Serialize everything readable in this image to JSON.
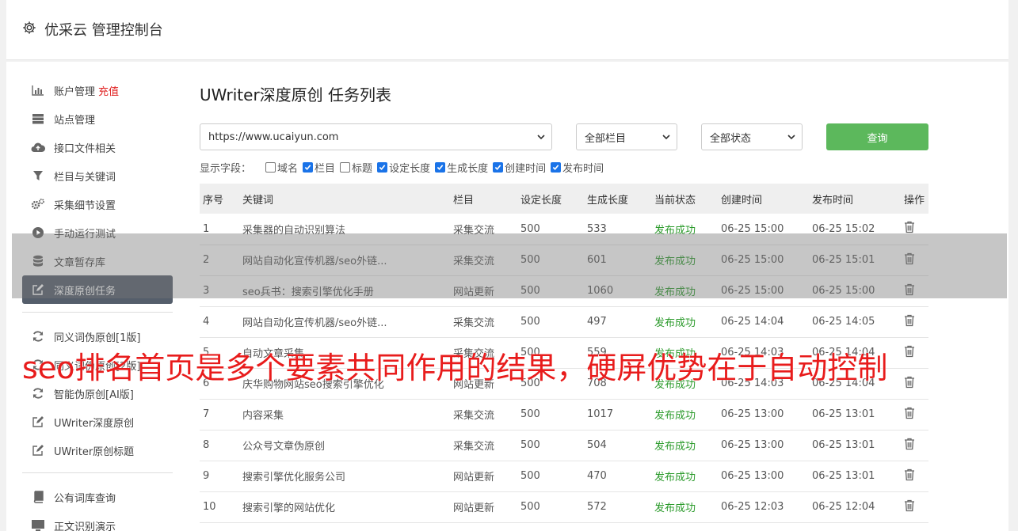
{
  "header": {
    "title": "优采云 管理控制台",
    "icon": "gear-icon"
  },
  "sidebar": {
    "groups": [
      [
        {
          "label": "账户管理",
          "badge": "充值",
          "icon": "bar-chart-icon"
        },
        {
          "label": "站点管理",
          "icon": "server-icon"
        },
        {
          "label": "接口文件相关",
          "icon": "cloud-upload-icon"
        },
        {
          "label": "栏目与关键词",
          "icon": "filter-icon"
        },
        {
          "label": "采集细节设置",
          "icon": "gears-icon"
        },
        {
          "label": "手动运行测试",
          "icon": "play-circle-icon"
        },
        {
          "label": "文章暂存库",
          "icon": "database-icon"
        },
        {
          "label": "深度原创任务",
          "icon": "edit-icon",
          "active": true
        }
      ],
      [
        {
          "label": "同义词伪原创[1版]",
          "icon": "refresh-icon"
        },
        {
          "label": "同义词伪原创[2版]",
          "icon": "refresh-icon"
        },
        {
          "label": "智能伪原创[AI版]",
          "icon": "refresh-icon"
        },
        {
          "label": "UWriter深度原创",
          "icon": "edit-icon"
        },
        {
          "label": "UWriter原创标题",
          "icon": "edit-icon"
        }
      ],
      [
        {
          "label": "公有词库查询",
          "icon": "book-icon"
        },
        {
          "label": "正文识别演示",
          "icon": "monitor-icon"
        }
      ]
    ]
  },
  "main": {
    "title": "UWriter深度原创 任务列表",
    "site_select": "https://www.ucaiyun.com",
    "column_select": "全部栏目",
    "status_select": "全部状态",
    "query_button": "查询",
    "fields_label": "显示字段：",
    "fields": [
      {
        "label": "域名",
        "checked": false
      },
      {
        "label": "栏目",
        "checked": true
      },
      {
        "label": "标题",
        "checked": false
      },
      {
        "label": "设定长度",
        "checked": true
      },
      {
        "label": "生成长度",
        "checked": true
      },
      {
        "label": "创建时间",
        "checked": true
      },
      {
        "label": "发布时间",
        "checked": true
      }
    ],
    "table": {
      "headers": [
        "序号",
        "关键词",
        "栏目",
        "设定长度",
        "生成长度",
        "当前状态",
        "创建时间",
        "发布时间",
        "操作"
      ],
      "rows": [
        [
          "1",
          "采集器的自动识别算法",
          "采集交流",
          "500",
          "533",
          "发布成功",
          "06-25 15:00",
          "06-25 15:02"
        ],
        [
          "2",
          "网站自动化宣传机器/seo外链...",
          "采集交流",
          "500",
          "601",
          "发布成功",
          "06-25 15:00",
          "06-25 15:01"
        ],
        [
          "3",
          "seo兵书：搜索引擎优化手册",
          "网站更新",
          "500",
          "1060",
          "发布成功",
          "06-25 15:00",
          "06-25 15:00"
        ],
        [
          "4",
          "网站自动化宣传机器/seo外链...",
          "采集交流",
          "500",
          "497",
          "发布成功",
          "06-25 14:04",
          "06-25 14:05"
        ],
        [
          "5",
          "自动文章采集",
          "采集交流",
          "500",
          "559",
          "发布成功",
          "06-25 14:03",
          "06-25 14:04"
        ],
        [
          "6",
          "庆华购物网站seo搜索引擎优化",
          "网站更新",
          "500",
          "708",
          "发布成功",
          "06-25 14:03",
          "06-25 14:04"
        ],
        [
          "7",
          "内容采集",
          "采集交流",
          "500",
          "1017",
          "发布成功",
          "06-25 13:00",
          "06-25 13:01"
        ],
        [
          "8",
          "公众号文章伪原创",
          "采集交流",
          "500",
          "504",
          "发布成功",
          "06-25 13:00",
          "06-25 13:01"
        ],
        [
          "9",
          "搜索引擎优化服务公司",
          "网站更新",
          "500",
          "470",
          "发布成功",
          "06-25 13:00",
          "06-25 13:01"
        ],
        [
          "10",
          "搜索引擎的网站优化",
          "网站更新",
          "500",
          "572",
          "发布成功",
          "06-25 12:03",
          "06-25 12:04"
        ]
      ]
    }
  },
  "overlay": {
    "caption": "seo排名首页是多个要素共同作用的结果，硬屏优势在于自动控制"
  },
  "colors": {
    "active_nav": "#555e6b",
    "query_button": "#5cb85c",
    "status_ok": "#2a9a2a",
    "overlay_text": "#e81c1c",
    "badge": "#e02020"
  }
}
